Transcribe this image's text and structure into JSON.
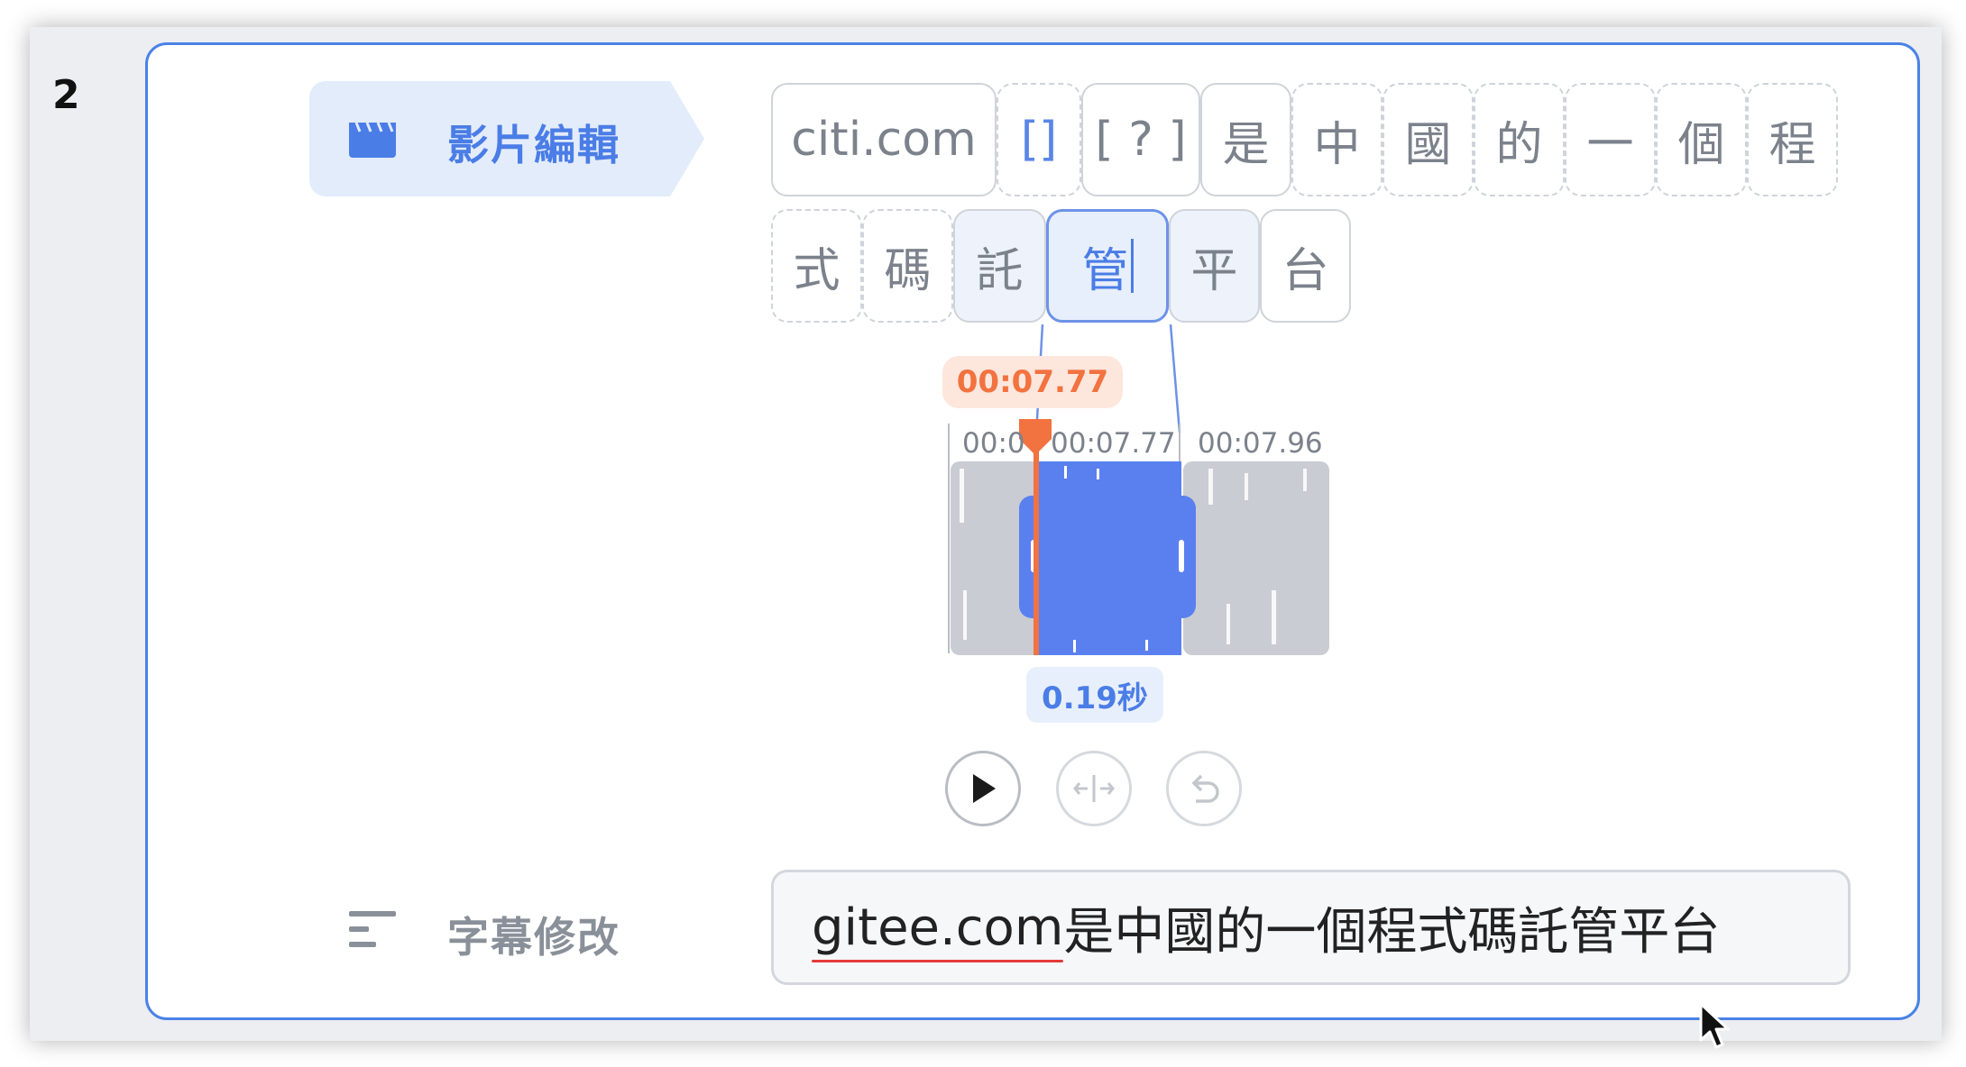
{
  "row": {
    "number": "2"
  },
  "sidebar": {
    "video_edit": {
      "label": "影片編輯",
      "icon": "clapperboard-icon"
    },
    "subtitle_edit": {
      "label": "字幕修改",
      "icon": "subtitle-lines-icon"
    }
  },
  "tokens": {
    "row1": [
      "citi.com",
      "[]",
      "[ ? ]",
      "是",
      "中",
      "國",
      "的",
      "一",
      "個",
      "程"
    ],
    "row2": [
      "式",
      "碼",
      "託",
      "管",
      "平",
      "台"
    ],
    "selected_index": 3
  },
  "timeline": {
    "playhead_time": "00:07.77",
    "tick_labels": [
      "00:0",
      "00:07.77",
      "00:07.96"
    ],
    "duration": "0.19秒"
  },
  "controls": {
    "play": "play-icon",
    "split": "split-icon",
    "undo": "undo-icon"
  },
  "subtitle_input": {
    "first_word": "gitee.com",
    "rest": "是中國的一個程式碼託管平台"
  },
  "colors": {
    "accent": "#4a7de6",
    "playhead": "#f27240",
    "waveform": "#c9ccd2"
  }
}
